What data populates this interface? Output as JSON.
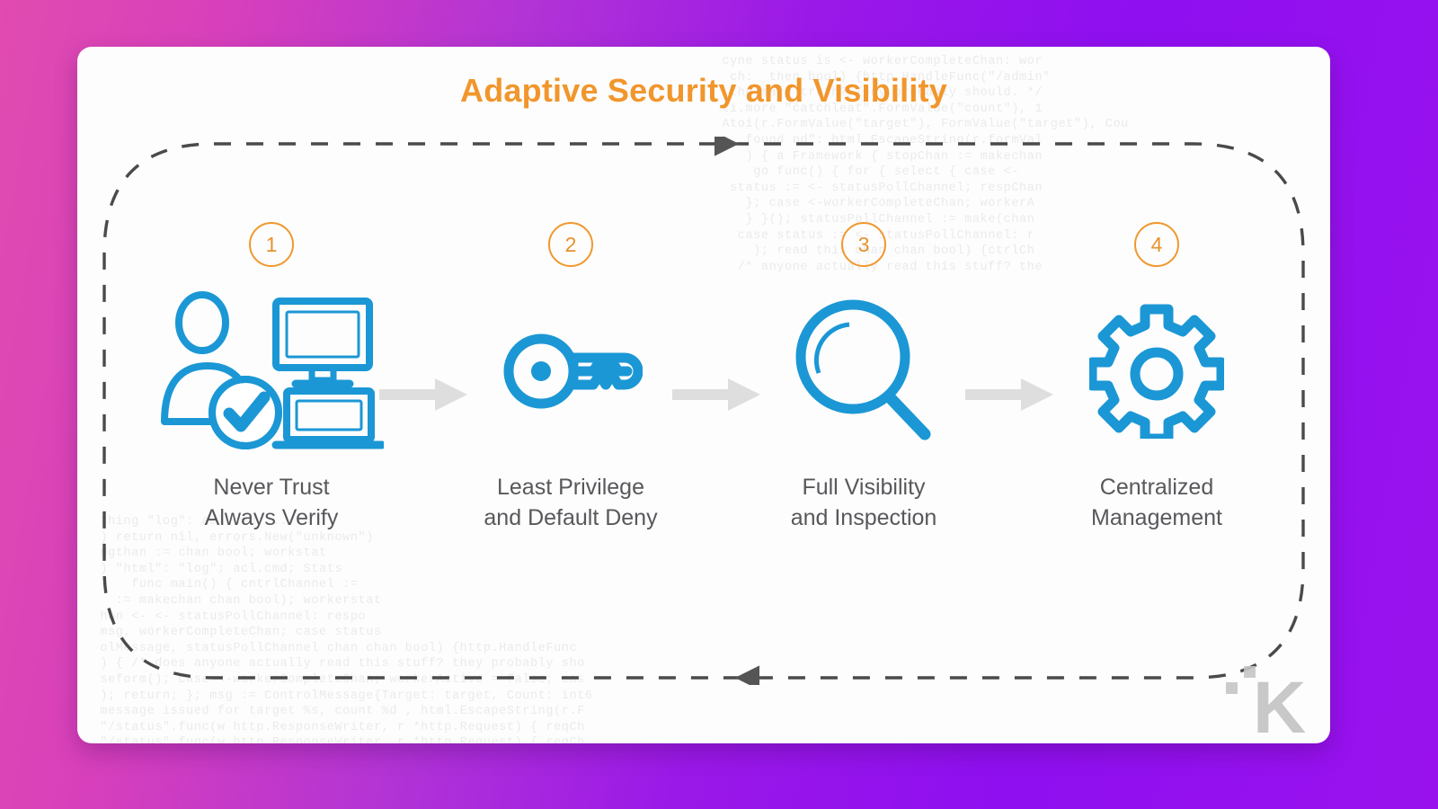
{
  "card": {
    "title": "Adaptive Security and Visibility",
    "title_color": "#f1962c",
    "accent_blue": "#1b97d5",
    "label_color": "#58585c",
    "arrow_color": "#dedede",
    "dash_color": "#4a4a4a"
  },
  "background": {
    "gradient_from": "#e04bb0",
    "gradient_to": "#9912ee"
  },
  "steps": [
    {
      "number": "1",
      "icon": "user-devices-verified-icon",
      "label": "Never Trust\nAlways Verify"
    },
    {
      "number": "2",
      "icon": "key-icon",
      "label": "Least Privilege\nand Default Deny"
    },
    {
      "number": "3",
      "icon": "magnifier-icon",
      "label": "Full Visibility\nand Inspection"
    },
    {
      "number": "4",
      "icon": "gear-icon",
      "label": "Centralized\nManagement"
    }
  ],
  "connectors": [
    {
      "name": "arrow-1-to-2",
      "direction": "right"
    },
    {
      "name": "arrow-2-to-3",
      "direction": "right"
    },
    {
      "name": "arrow-3-to-4",
      "direction": "right"
    }
  ],
  "loop": {
    "top_arrow_direction": "right",
    "bottom_arrow_direction": "left",
    "style": "dashed"
  },
  "watermark": {
    "letter": "K"
  },
  "code_texture": {
    "right_block": "  cyne status is <- workerCompleteChan: wor\n   ch:  then bool) {http.HandleFunc(\"/admin\"\n   the safe truth? They probably should. */\n  ti.more \"catchleat\".FormValue(\"count\"), 1\n  Atoi(r.FormValue(\"target\"), FormValue(\"target\"), Cou\n  r. found nd\": html.EscapeString(r.formVal\n     ) { a Framework { stopChan := makechan\n      go func() { for { select { case <- \n   status := <- statusPollChannel; respChan\n     }; case <-workerCompleteChan; workerA\n     } }(); statusPollChannel := make(chan\n    case status := <- statusPollChannel: r\n      ); read this chan chan bool) {ctrlCh\n    /* anyone actually read this stuff? the",
    "left_block": "  thing \"log\": acl.cmd; ...\n  ) return nil, errors.New(\"unknown\")\n  ngthan := chan bool; workstat\n  ) \"html\": \"log\"; acl.cmd; Stats\n      func main() { cntrlChannel :=\n    := makechan chan bool); workerstat\n  han <- <- statusPollChannel: respo\n  msg, workerCompleteChan; case status\n  olMessage, statusPollChannel chan chan bool) {http.HandleFunc\n  ) { /* does anyone actually read this stuff? they probably sho\n  seform(); case <-workerCompleteChan; workerActive = false; cas\n  ); return; }; msg := ControlMessage{Target: target, Count: int6\n  message issued for target %s, count %d , html.EscapeString(r.F\n  \"/status\".func(w http.ResponseWriter, r *http.Request) { reqCh\n  \"/status\".func(w http.ResponseWriter, r *http.Request) { reqCh"
  }
}
